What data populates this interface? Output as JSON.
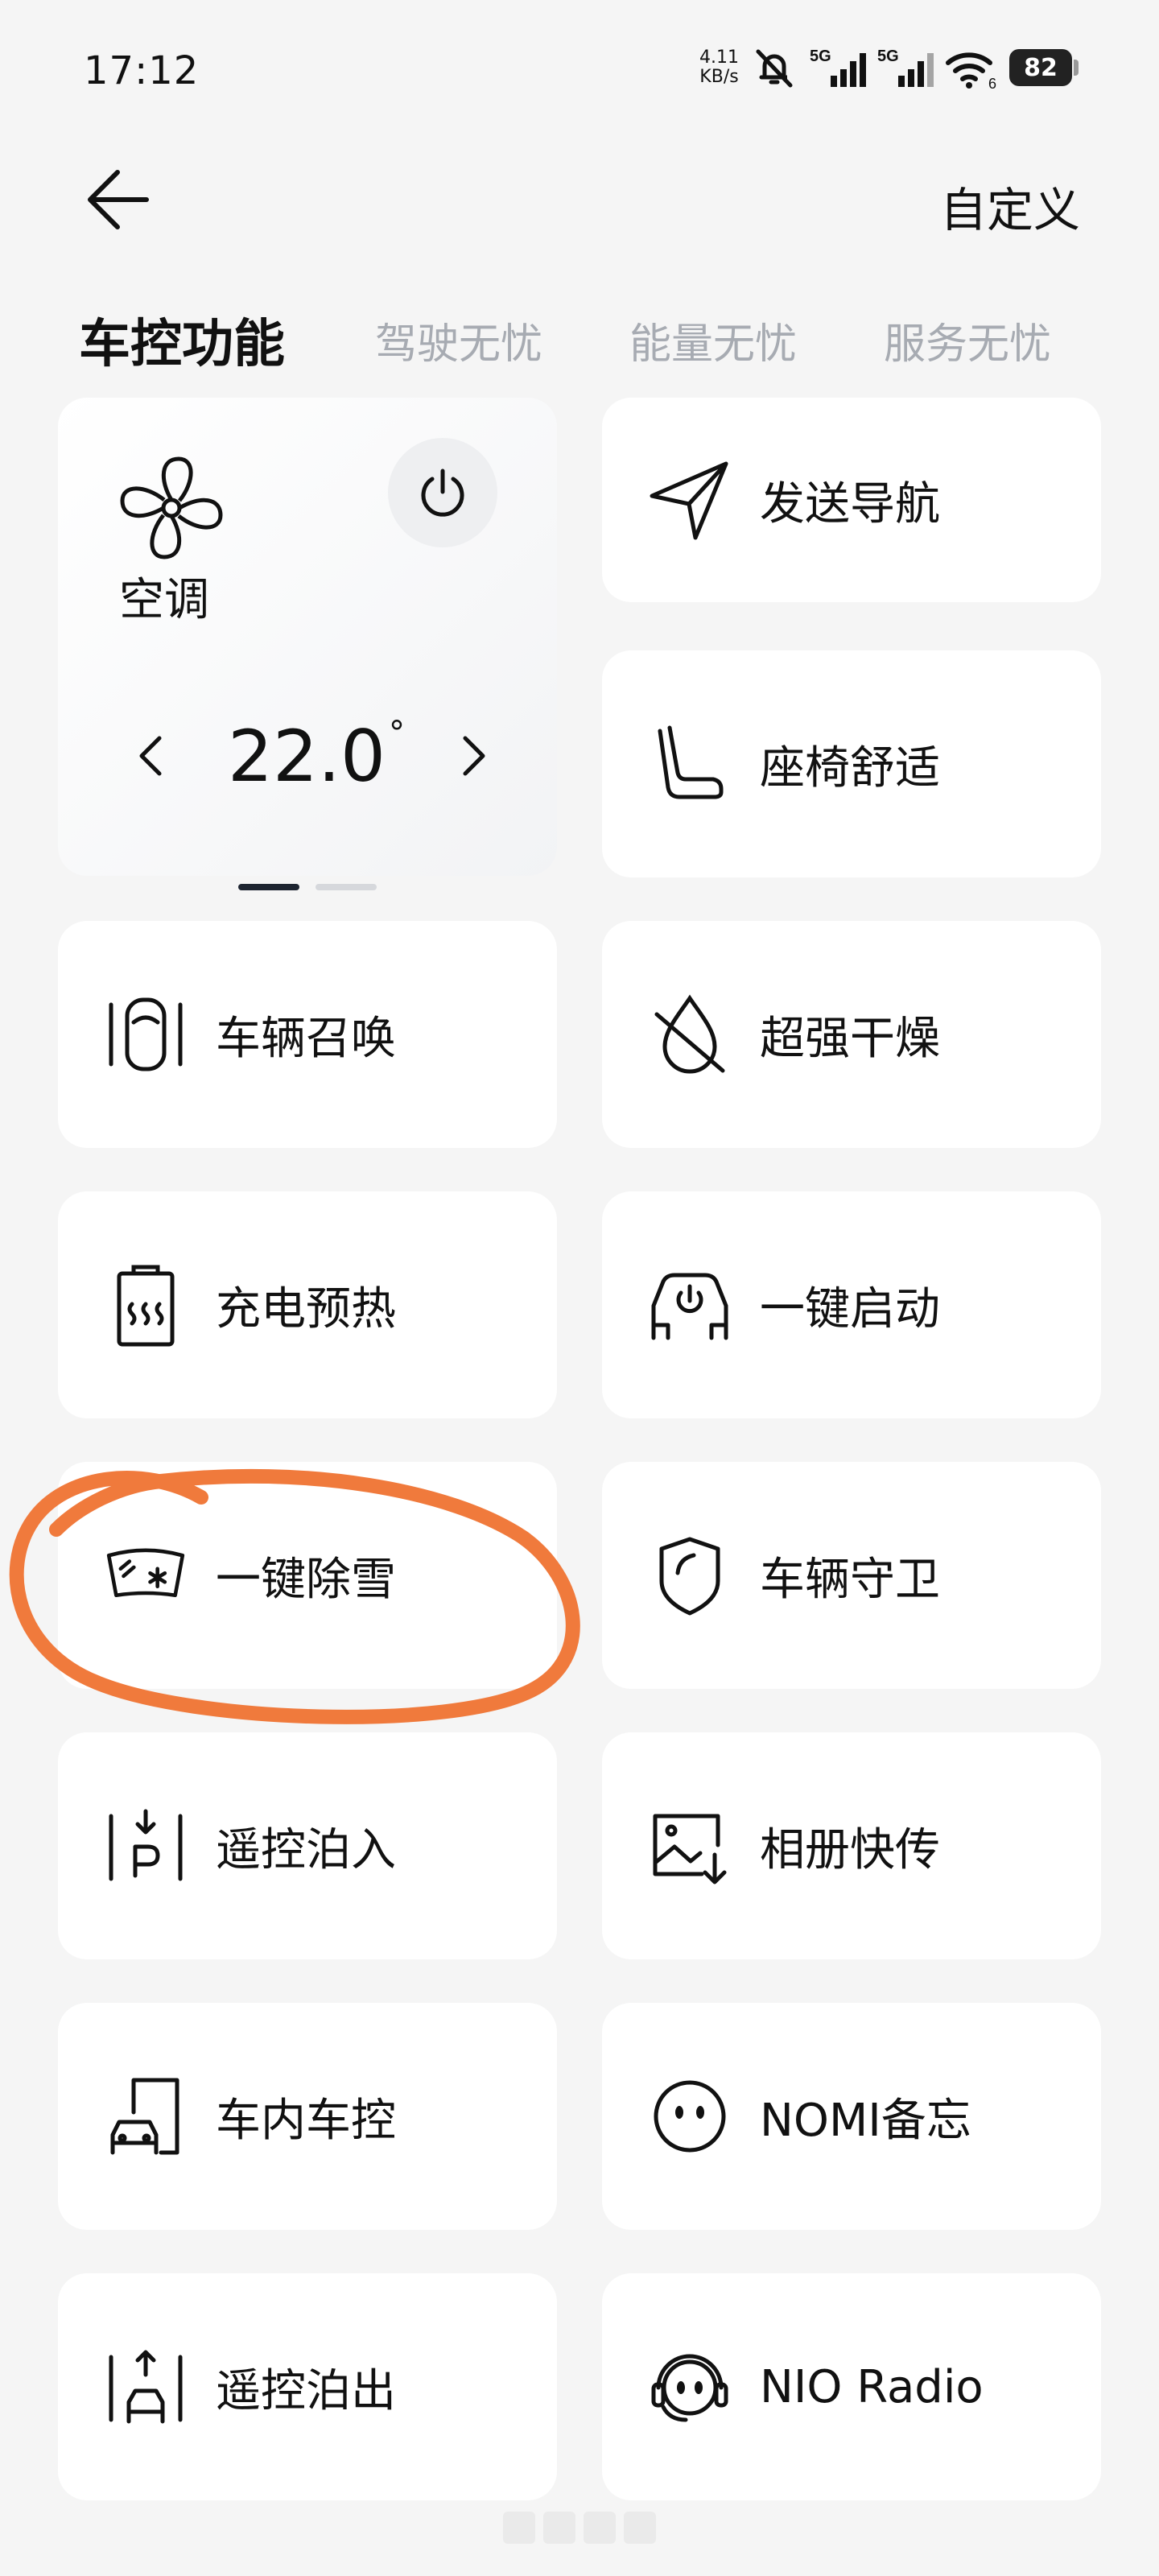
{
  "status_bar": {
    "time": "17:12",
    "net_speed_value": "4.11",
    "net_speed_unit": "KB/s",
    "signal1_label": "5G",
    "signal2_label": "5G",
    "wifi_badge": "6",
    "battery": "82",
    "icons": [
      "bell-off-icon",
      "signal-icon",
      "signal-icon",
      "wifi-icon",
      "battery-icon"
    ]
  },
  "header": {
    "back_icon": "arrow-left-icon",
    "customize": "自定义"
  },
  "tabs": [
    {
      "label": "车控功能",
      "active": true
    },
    {
      "label": "驾驶无忧",
      "active": false
    },
    {
      "label": "能量无忧",
      "active": false
    },
    {
      "label": "服务无忧",
      "active": false
    }
  ],
  "ac": {
    "label": "空调",
    "temperature": "22.0",
    "unit": "°",
    "icons": [
      "fan-icon",
      "power-icon",
      "chevron-left-icon",
      "chevron-right-icon"
    ]
  },
  "pager": {
    "count": 2,
    "active": 0
  },
  "cards": [
    {
      "label": "发送导航",
      "icon": "navigation-icon"
    },
    {
      "label": "座椅舒适",
      "icon": "seat-icon"
    },
    {
      "label": "车辆召唤",
      "icon": "car-summon-icon"
    },
    {
      "label": "超强干燥",
      "icon": "dry-icon"
    },
    {
      "label": "充电预热",
      "icon": "battery-heat-icon"
    },
    {
      "label": "一键启动",
      "icon": "car-start-icon"
    },
    {
      "label": "一键除雪",
      "icon": "windshield-snow-icon"
    },
    {
      "label": "车辆守卫",
      "icon": "shield-icon"
    },
    {
      "label": "遥控泊入",
      "icon": "park-in-icon"
    },
    {
      "label": "相册快传",
      "icon": "photo-transfer-icon"
    },
    {
      "label": "车内车控",
      "icon": "in-car-control-icon"
    },
    {
      "label": "NOMI备忘",
      "icon": "nomi-icon"
    },
    {
      "label": "遥控泊出",
      "icon": "park-out-icon"
    },
    {
      "label": "NIO Radio",
      "icon": "radio-icon"
    }
  ],
  "colors": {
    "background": "#f5f5f5",
    "card": "#ffffff",
    "text": "#111111",
    "tab_inactive": "#a7abb2",
    "annotation": "#f07a3c"
  }
}
